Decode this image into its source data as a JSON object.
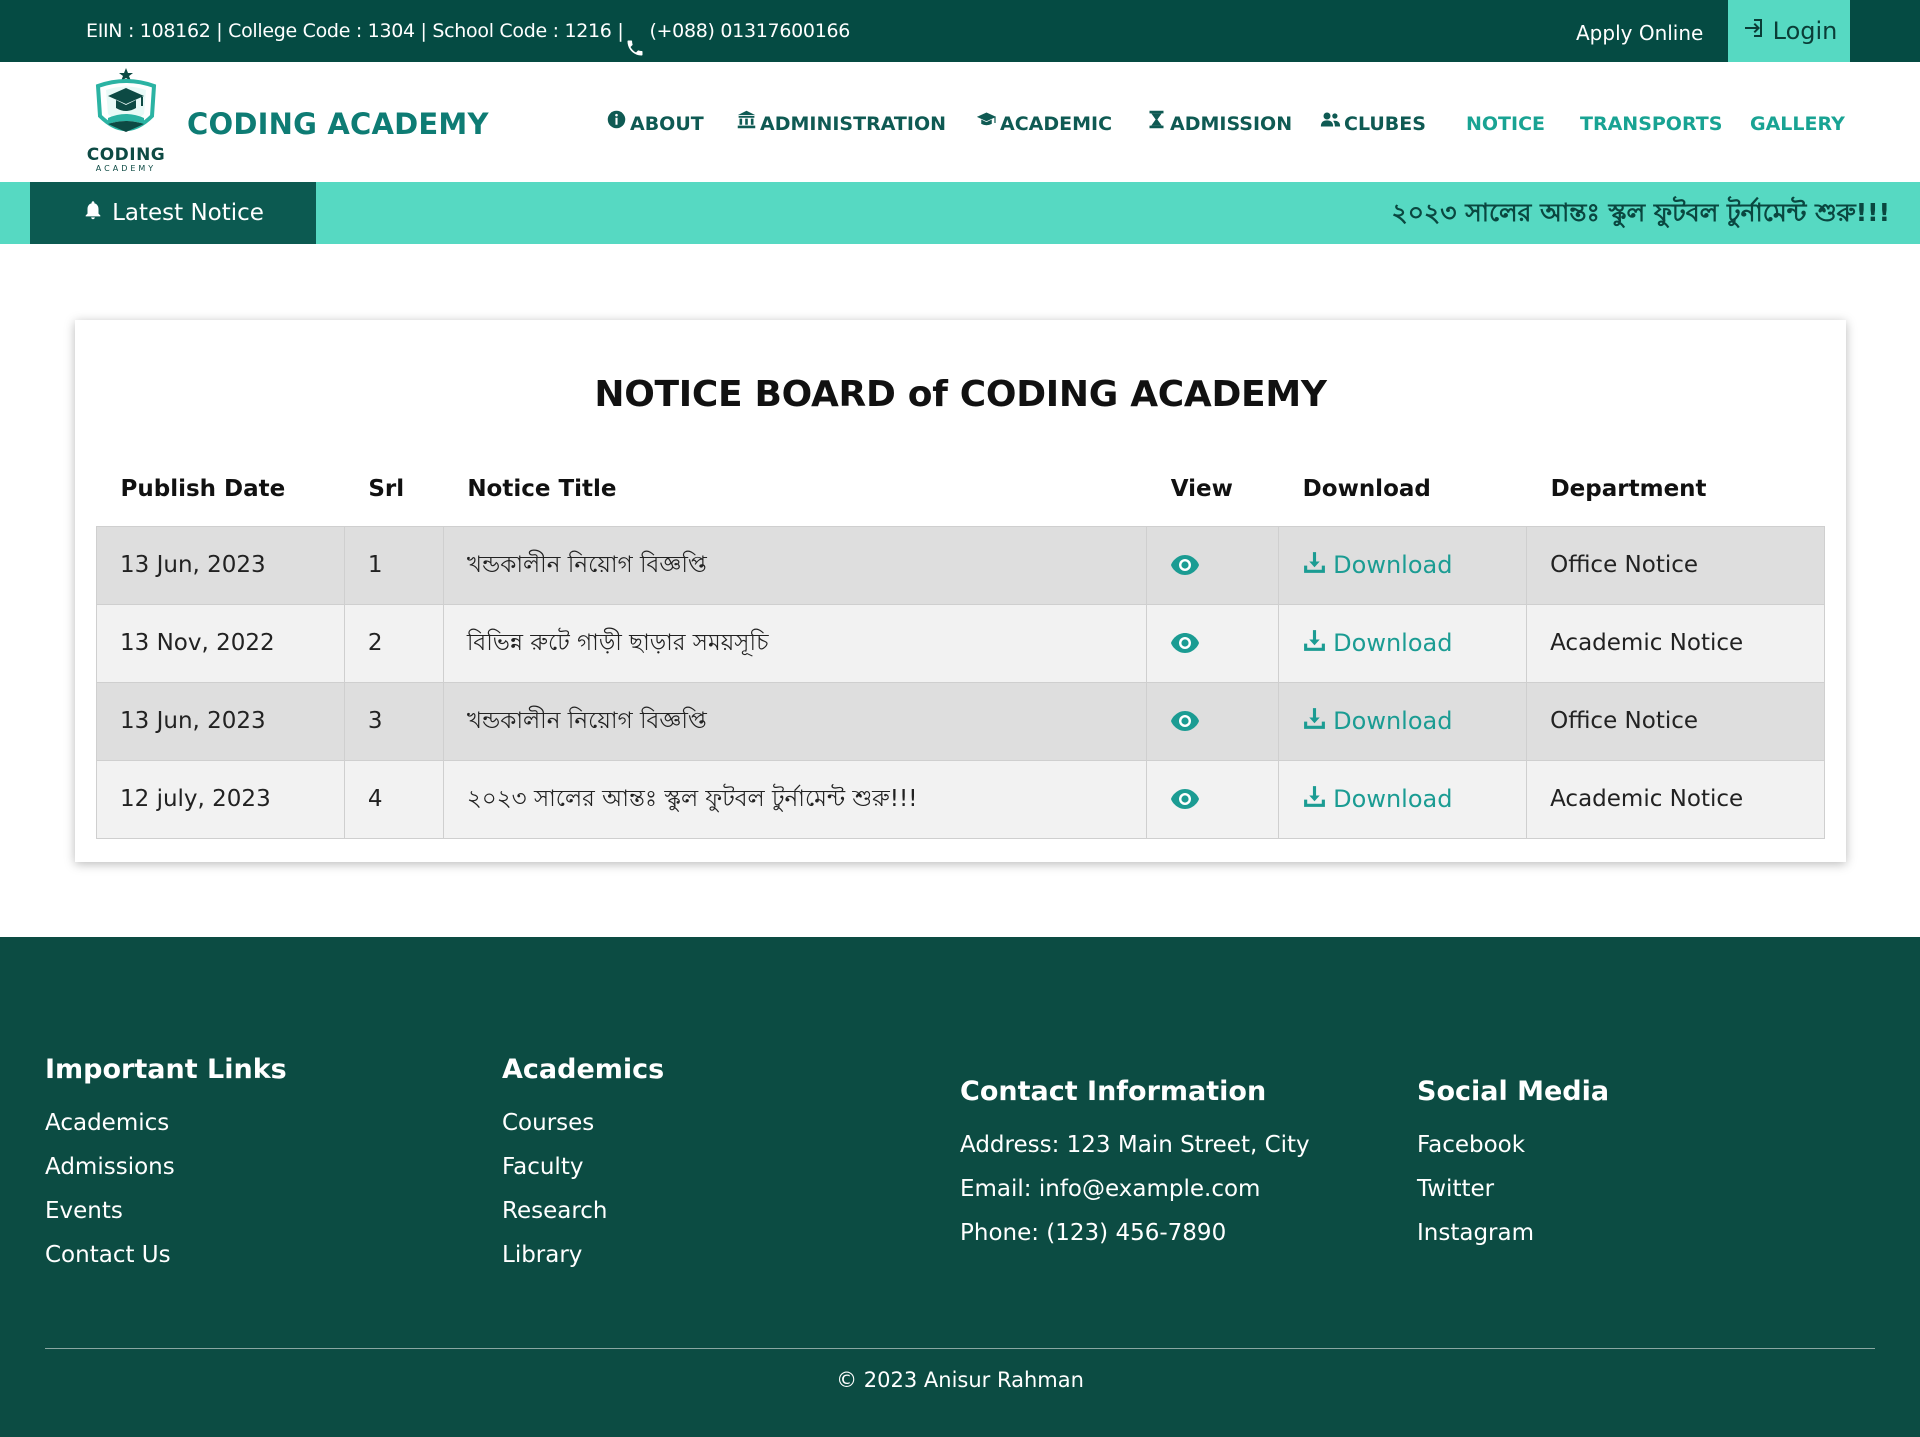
{
  "topbar": {
    "info_text": "EIIN : 108162 | College Code : 1304 | School Code : 1216 |",
    "phone_text": "(+088) 01317600166",
    "apply_label": "Apply Online",
    "login_label": "Login"
  },
  "header": {
    "logo_text": "CODING",
    "logo_sub": "ACADEMY",
    "brand": "CODING ACADEMY",
    "nav": [
      {
        "label": "ABOUT",
        "icon": "info-icon"
      },
      {
        "label": "ADMINISTRATION",
        "icon": "building-icon"
      },
      {
        "label": "ACADEMIC",
        "icon": "graduation-cap-icon"
      },
      {
        "label": "ADMISSION",
        "icon": "hourglass-icon"
      },
      {
        "label": "CLUBES",
        "icon": "users-icon"
      },
      {
        "label": "NOTICE"
      },
      {
        "label": "TRANSPORTS"
      },
      {
        "label": "GALLERY"
      }
    ]
  },
  "ticker": {
    "badge_label": "Latest Notice",
    "text": "২০২৩ সালের আন্তঃ স্কুল ফুটবল টুর্নামেন্ট শুরু!!!"
  },
  "notice_board": {
    "title": "NOTICE BOARD of CODING ACADEMY",
    "columns": [
      "Publish Date",
      "Srl",
      "Notice Title",
      "View",
      "Download",
      "Department"
    ],
    "download_label": "Download",
    "rows": [
      {
        "date": "13 Jun, 2023",
        "srl": "1",
        "title": "খন্ডকালীন নিয়োগ বিজ্ঞপ্তি",
        "department": "Office Notice"
      },
      {
        "date": "13 Nov, 2022",
        "srl": "2",
        "title": "বিভিন্ন রুটে গাড়ী ছাড়ার সময়সূচি",
        "department": "Academic Notice"
      },
      {
        "date": "13 Jun, 2023",
        "srl": "3",
        "title": "খন্ডকালীন নিয়োগ বিজ্ঞপ্তি",
        "department": "Office Notice"
      },
      {
        "date": "12 july, 2023",
        "srl": "4",
        "title": "২০২৩ সালের আন্তঃ স্কুল ফুটবল টুর্নামেন্ট শুরু!!!",
        "department": "Academic Notice"
      }
    ]
  },
  "footer": {
    "important_links": {
      "heading": "Important Links",
      "items": [
        "Academics",
        "Admissions",
        "Events",
        "Contact Us"
      ]
    },
    "academics": {
      "heading": "Academics",
      "items": [
        "Courses",
        "Faculty",
        "Research",
        "Library"
      ]
    },
    "contact": {
      "heading": "Contact Information",
      "items": [
        "Address: 123 Main Street, City",
        "Email: info@example.com",
        "Phone: (123) 456-7890"
      ]
    },
    "social": {
      "heading": "Social Media",
      "items": [
        "Facebook",
        "Twitter",
        "Instagram"
      ]
    },
    "copyright": "© 2023 Anisur Rahman"
  },
  "colors": {
    "topbar": "#054b43",
    "accent": "#56d9c2",
    "brand": "#0e7c74",
    "link": "#1b9c93",
    "footer": "#0c4c43"
  }
}
